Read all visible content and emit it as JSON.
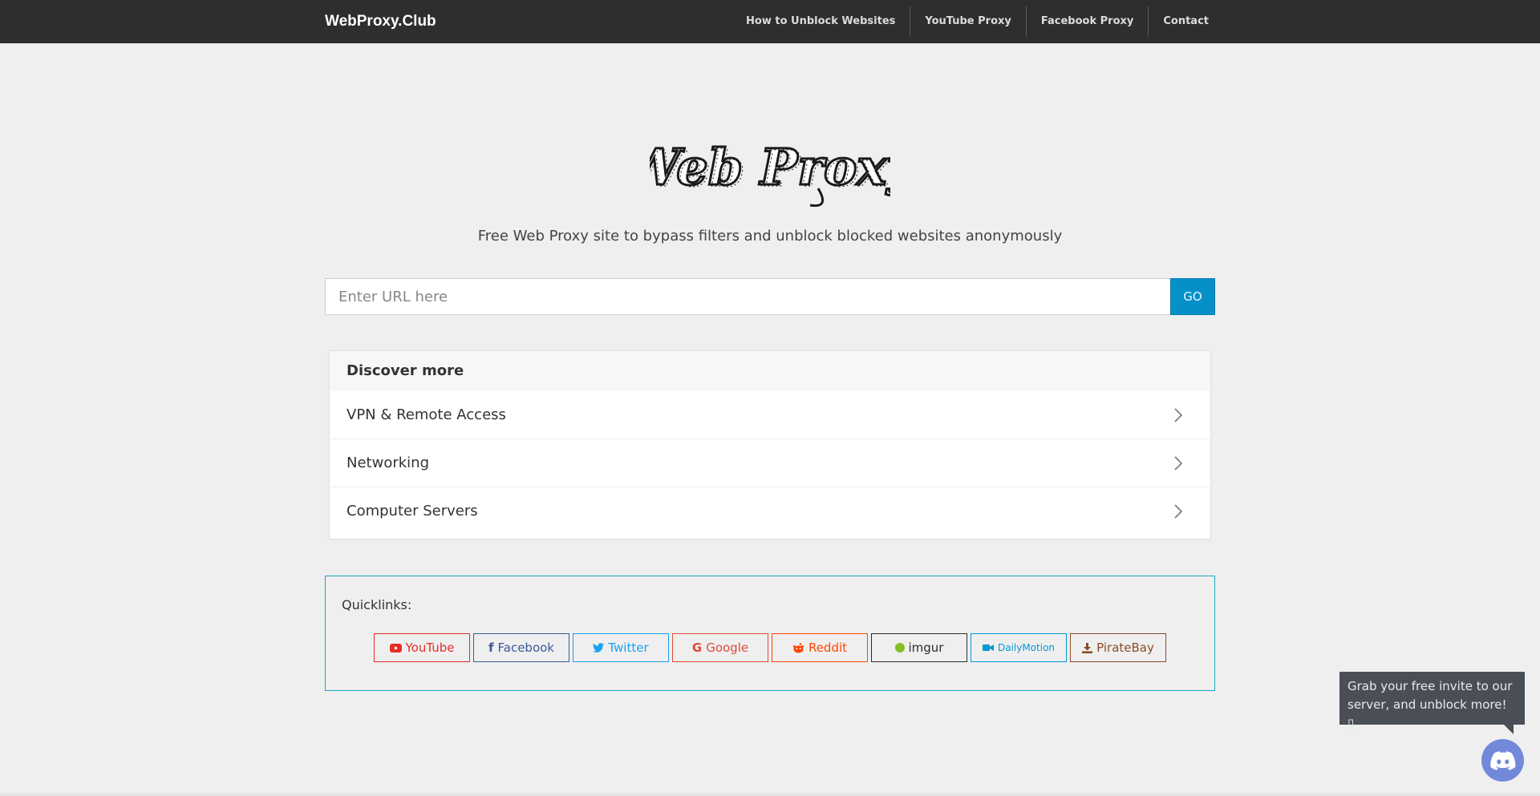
{
  "navbar": {
    "brand": "WebProxy.Club",
    "links": [
      "How to Unblock Websites",
      "YouTube Proxy",
      "Facebook Proxy",
      "Contact"
    ]
  },
  "logo": {
    "text": "Web Proxy"
  },
  "tagline": "Free Web Proxy site to bypass filters and unblock blocked websites anonymously",
  "url_form": {
    "placeholder": "Enter URL here",
    "value": "",
    "go_label": "GO"
  },
  "discover": {
    "title": "Discover more",
    "items": [
      "VPN & Remote Access",
      "Networking",
      "Computer Servers"
    ]
  },
  "quicklinks": {
    "label": "Quicklinks:",
    "items": [
      {
        "label": "YouTube",
        "icon": "youtube-icon",
        "color": "#e52d27"
      },
      {
        "label": "Facebook",
        "icon": "facebook-icon",
        "color": "#3b5998"
      },
      {
        "label": "Twitter",
        "icon": "twitter-icon",
        "color": "#1da1f2"
      },
      {
        "label": "Google",
        "icon": "google-icon",
        "color": "#dd4b39"
      },
      {
        "label": "Reddit",
        "icon": "reddit-icon",
        "color": "#ff4500"
      },
      {
        "label": "imgur",
        "icon": "imgur-icon",
        "color": "#2b2b2b"
      },
      {
        "label": "DailyMotion",
        "icon": "video-camera-icon",
        "color": "#0099d6"
      },
      {
        "label": "PirateBay",
        "icon": "download-icon",
        "color": "#8b4a2b"
      }
    ]
  },
  "discord_widget": {
    "tooltip": "Grab your free invite to our server, and unblock more! ",
    "tooltip_suffix": "▯",
    "icon": "discord-icon"
  },
  "colors": {
    "navbar_bg": "#2e2e2e",
    "go_button": "#0591c8",
    "quicklinks_border": "#19a7bd",
    "discord": "#7289da"
  }
}
